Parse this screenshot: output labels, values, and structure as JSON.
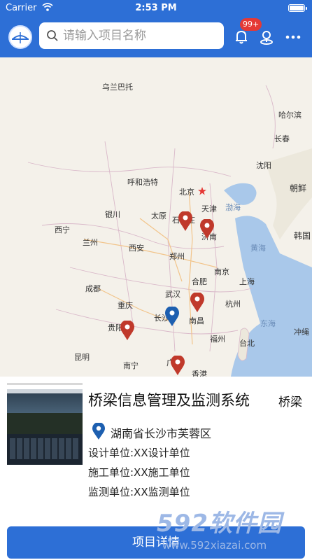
{
  "status_bar": {
    "carrier": "Carrier",
    "time": "2:53 PM"
  },
  "header": {
    "search_placeholder": "请输入项目名称",
    "badge": "99+"
  },
  "map": {
    "labels": {
      "wulanbatuo": "乌兰巴托",
      "haerbin": "哈尔滨",
      "changchun": "长春",
      "huhehaote": "呼和浩特",
      "shenyang": "沈阳",
      "chaoxian": "朝鲜",
      "beijing": "北京",
      "tianjin": "天津",
      "bohai": "渤海",
      "yinchuan": "银川",
      "taiyuan": "太原",
      "shijiazhuang": "石家庄",
      "jinan": "济南",
      "hanguo": "韩国",
      "xining": "西宁",
      "lanzhou": "兰州",
      "xian": "西安",
      "zhengzhou": "郑州",
      "huanghai": "黄海",
      "nanjing": "南京",
      "hefei": "合肥",
      "shanghai": "上海",
      "chengdu": "成都",
      "wuhan": "武汉",
      "chongqing": "重庆",
      "hangzhou": "杭州",
      "changsha": "长沙",
      "nanchang": "南昌",
      "guiyang": "贵阳",
      "donghai": "东海",
      "chongsheng": "冲绳",
      "fuzhou": "福州",
      "kunming": "昆明",
      "taibei": "台北",
      "nanning": "南宁",
      "guang": "广",
      "xianggang": "香港"
    }
  },
  "card": {
    "title": "桥梁信息管理及监测系统",
    "tag": "桥梁",
    "address": "湖南省长沙市芙蓉区",
    "design_unit": "设计单位:XX设计单位",
    "construction_unit": "施工单位:XX施工单位",
    "monitor_unit": "监测单位:XX监测单位",
    "detail_button": "项目详情"
  },
  "watermark": {
    "brand": "592软件园",
    "url": "www.592xiazai.com"
  },
  "colors": {
    "primary": "#2d6fd6",
    "pin_red": "#c0392b",
    "pin_blue": "#1d5fb0",
    "badge": "#e53935"
  }
}
